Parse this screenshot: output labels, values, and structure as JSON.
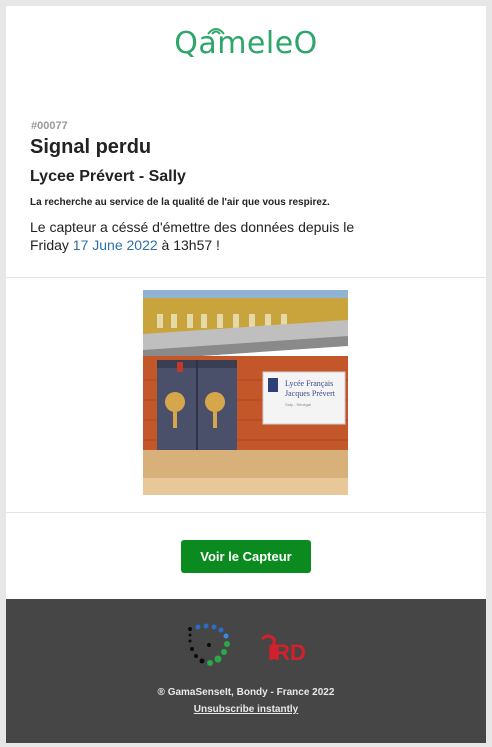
{
  "header": {
    "logo_text": "QameleO"
  },
  "alert": {
    "reference": "#00077",
    "title": "Signal perdu",
    "sensor_name": "Lycee Prévert - Sally",
    "tagline": "La recherche au service de la qualité de l'air que vous respirez.",
    "message_part1": "Le capteur a céssé d'émettre des données depuis le Friday ",
    "message_date": "17 June 2022",
    "message_part2": " à 13h57 !"
  },
  "photo": {
    "sign_line1": "Lycée Français",
    "sign_line2": "Jacques Prévert",
    "sign_line3": "Saly - Sénégal"
  },
  "cta": {
    "label": "Voir le Capteur"
  },
  "footer": {
    "partner2_logo_text": "IRD",
    "copyright": "® GamaSenseIt, Bondy - France 2022",
    "unsubscribe": "Unsubscribe instantly"
  },
  "colors": {
    "brand_green": "#2ea66a",
    "button_green": "#0b8a20",
    "link_blue": "#2f6fa7",
    "footer_bg": "#464646",
    "ird_red": "#d3202a"
  }
}
